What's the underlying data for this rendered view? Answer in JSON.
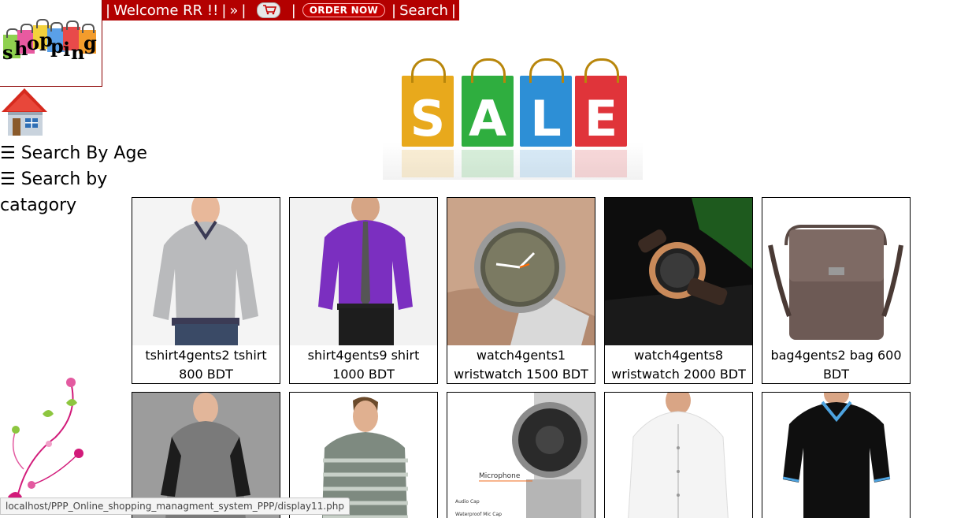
{
  "topbar": {
    "welcome": "Welcome RR !!",
    "arrow": "»",
    "order_now": "ORDER NOW",
    "search": "Search",
    "cart_icon": "cart-icon"
  },
  "logo": {
    "letters": [
      "s",
      "h",
      "o",
      "p",
      "p",
      "i",
      "n",
      "g"
    ]
  },
  "side_menu": {
    "search_by_age": "☰ Search By Age",
    "search_by_category_line1": "☰ Search by",
    "search_by_category_line2": "catagory"
  },
  "banner": {
    "letters": [
      "S",
      "A",
      "L",
      "E"
    ]
  },
  "products": [
    {
      "caption_line1": "tshirt4gents2 tshirt",
      "caption_line2": "800 BDT"
    },
    {
      "caption_line1": "shirt4gents9 shirt",
      "caption_line2": "1000 BDT"
    },
    {
      "caption_line1": "watch4gents1",
      "caption_line2": "wristwatch 1500 BDT"
    },
    {
      "caption_line1": "watch4gents8",
      "caption_line2": "wristwatch 2000 BDT"
    },
    {
      "caption_line1": "bag4gents2 bag 600",
      "caption_line2": "BDT"
    }
  ],
  "status_bar": {
    "url": "localhost/PPP_Online_shopping_managment_system_PPP/display11.php"
  },
  "colors": {
    "topbar_bg": "#b30000",
    "accent_red": "#c40000"
  }
}
